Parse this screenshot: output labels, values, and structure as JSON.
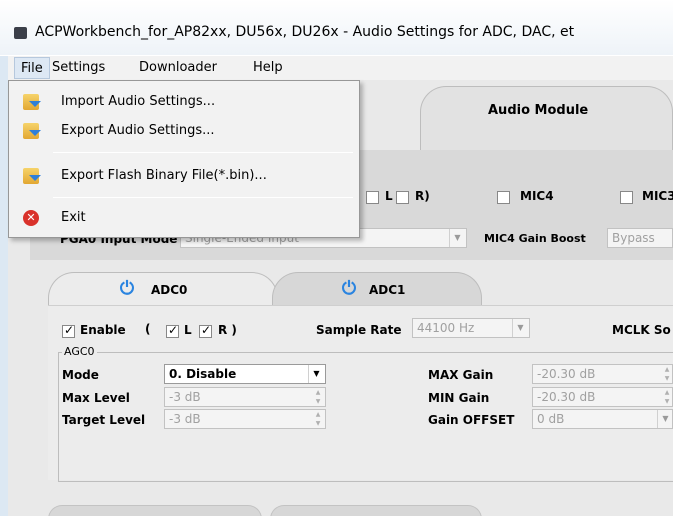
{
  "window": {
    "title": "ACPWorkbench_for_AP82xx, DU56x, DU26x - Audio Settings for ADC, DAC, et"
  },
  "menubar": {
    "items": [
      "File",
      "Settings",
      "Downloader",
      "Help"
    ]
  },
  "file_menu": {
    "items": [
      {
        "label": "Import Audio Settings...",
        "icon": "folder-import-icon"
      },
      {
        "label": "Export Audio Settings...",
        "icon": "folder-export-icon"
      },
      {
        "label": "Export Flash Binary File(*.bin)...",
        "icon": "folder-export-icon"
      },
      {
        "label": "Exit",
        "icon": "exit-icon"
      }
    ]
  },
  "top_tabs": {
    "audio_module": "Audio Module"
  },
  "mic_row": {
    "l": "L",
    "r": "R)",
    "mic4": "MIC4",
    "mic3": "MIC3"
  },
  "pga_row": {
    "mode_label": "PGA0 Input Mode",
    "mode_value": "Single-Ended Input",
    "mic4_gain_label": "MIC4 Gain Boost",
    "mic4_gain_value": "Bypass"
  },
  "adc_tabs": {
    "adc0": "ADC0",
    "adc1": "ADC1"
  },
  "adc0": {
    "enable_label": "Enable",
    "enable_checked": true,
    "paren_open": "(",
    "l_label": "L",
    "l_checked": true,
    "r_label": "R )",
    "r_checked": true,
    "sample_rate_label": "Sample Rate",
    "sample_rate_value": "44100 Hz",
    "mclk_label": "MCLK So"
  },
  "agc0": {
    "title": "AGC0",
    "mode_label": "Mode",
    "mode_value": "0. Disable",
    "max_level_label": "Max Level",
    "max_level_value": "-3 dB",
    "target_level_label": "Target Level",
    "target_level_value": "-3 dB",
    "max_gain_label": "MAX Gain",
    "max_gain_value": "-20.30 dB",
    "min_gain_label": "MIN Gain",
    "min_gain_value": "-20.30 dB",
    "gain_offset_label": "Gain OFFSET",
    "gain_offset_value": "0 dB"
  }
}
